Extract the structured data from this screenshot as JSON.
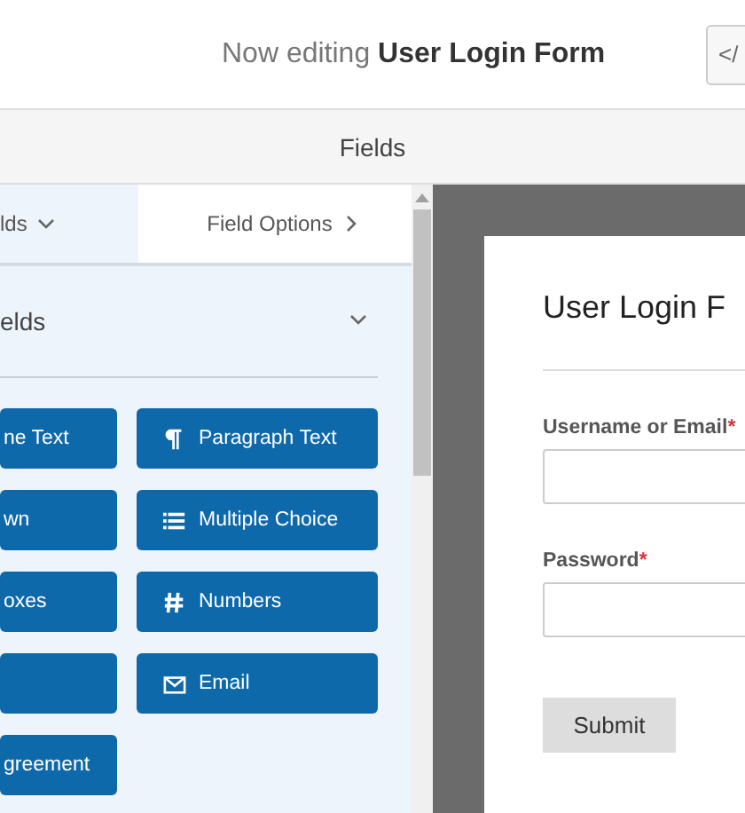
{
  "header": {
    "title": "Now editing **User Login Form**",
    "code_button": "</"
  },
  "nav": {
    "title": "Fields"
  },
  "panel_tabs": [
    {
      "label": "lds",
      "selected": true
    },
    {
      "label": "Field Options",
      "selected": false
    }
  ],
  "section": {
    "title": "elds",
    "expanded": true
  },
  "field_buttons": [
    {
      "kind": "text",
      "label": "ne Text"
    },
    {
      "kind": "icon",
      "label": "Paragraph Text"
    },
    {
      "kind": "text",
      "label": "wn"
    },
    {
      "kind": "icon",
      "label": "Multiple Choice"
    },
    {
      "kind": "text",
      "label": "oxes"
    },
    {
      "kind": "icon",
      "label": "Numbers"
    },
    {
      "kind": "blank"
    },
    {
      "kind": "icon",
      "label": "Email"
    },
    {
      "kind": "text",
      "label": "greement"
    }
  ],
  "form": {
    "title": "User Login F",
    "fields": [
      {
        "label": "Username or Email",
        "required_mark": "*"
      },
      {
        "label": "Password",
        "required_mark": "*"
      }
    ],
    "submit": "Submit"
  }
}
